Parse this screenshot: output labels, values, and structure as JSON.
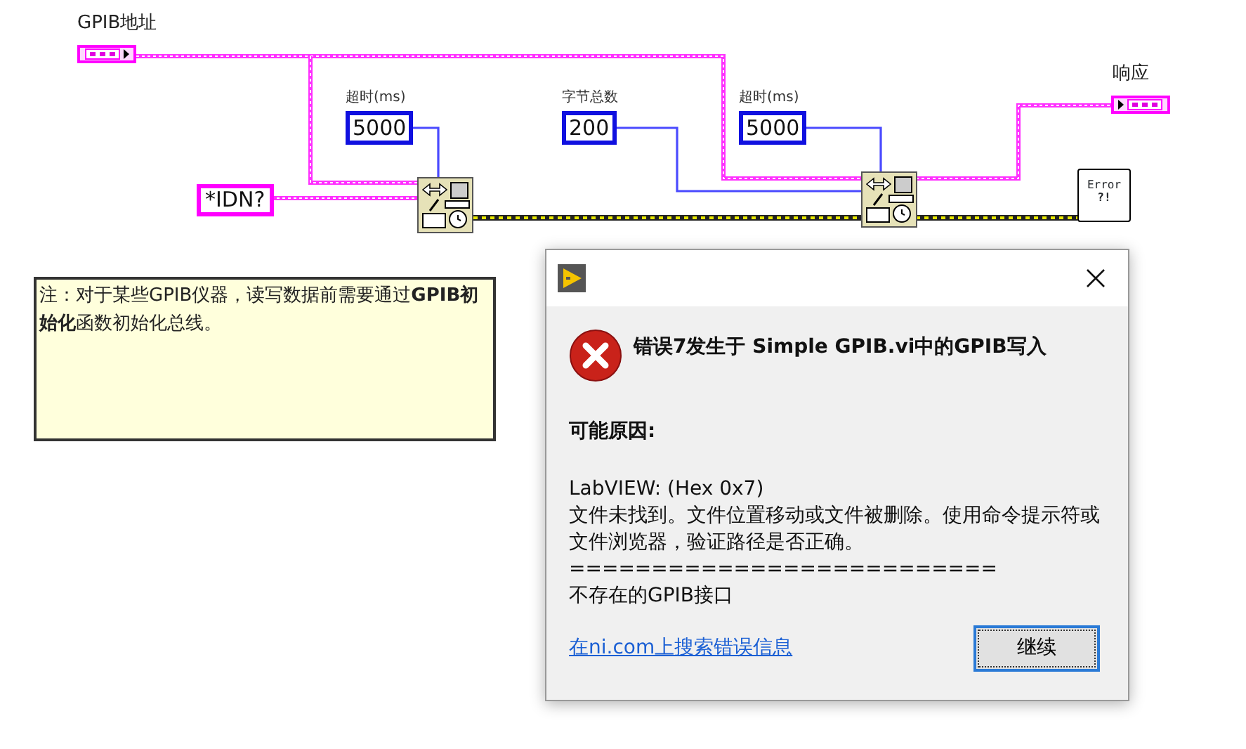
{
  "diagram": {
    "controls": [
      {
        "label": "GPIB地址",
        "kind": "control"
      },
      {
        "label": "响应",
        "kind": "indicator"
      }
    ],
    "constants": [
      {
        "kind": "string",
        "value": "*IDN?"
      },
      {
        "kind": "numeric",
        "label": "超时(ms)",
        "value": "5000"
      },
      {
        "kind": "numeric",
        "label": "字节总数",
        "value": "200"
      },
      {
        "kind": "numeric",
        "label": "超时(ms)",
        "value": "5000"
      }
    ],
    "error_handler": {
      "line1": "Error",
      "line2": "?!"
    },
    "note": "注：对于某些GPIB仪器，读写数据前需要通过**GPIB初始化**函数初始化总线。"
  },
  "dialog": {
    "heading": "错误7发生于 Simple GPIB.vi中的GPIB写入",
    "section_title": "可能原因:",
    "lines": [
      "LabVIEW: (Hex 0x7)",
      "文件未找到。文件位置移动或文件被删除。使用命令提示符或文件浏览器，验证路径是否正确。",
      "==========================",
      "不存在的GPIB接口"
    ],
    "link": "在ni.com上搜索错误信息",
    "button": "继续"
  }
}
